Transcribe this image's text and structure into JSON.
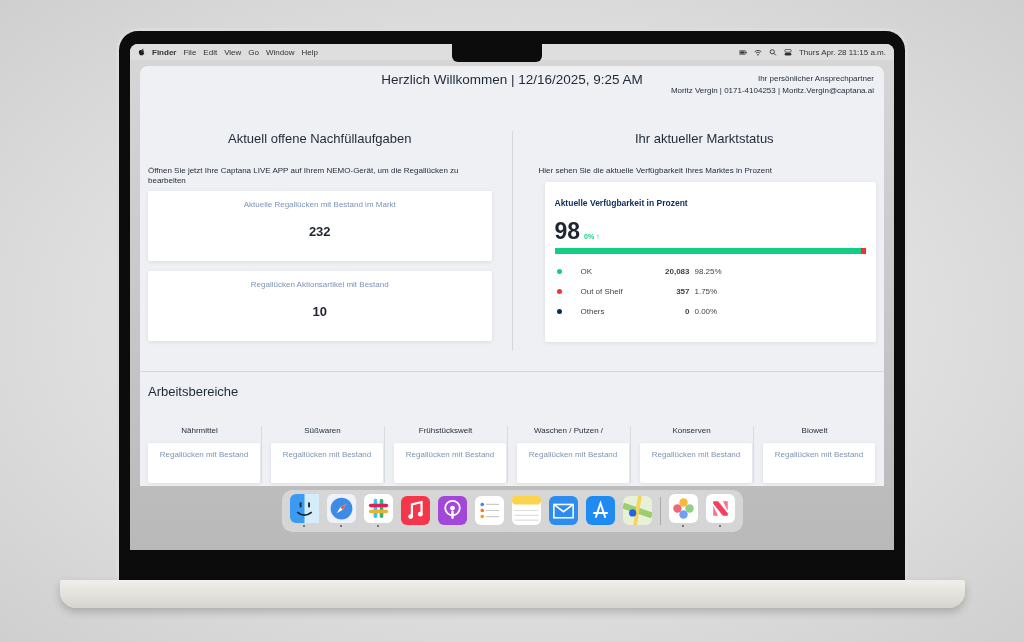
{
  "menubar": {
    "app": "Finder",
    "menus": [
      "File",
      "Edit",
      "View",
      "Go",
      "Window",
      "Help"
    ],
    "clock": "Thurs Apr. 28 11:15 a.m."
  },
  "app": {
    "title": "Herzlich Willkommen | 12/16/2025, 9:25 AM",
    "contact": {
      "label": "Ihr persönlicher Ansprechpartner",
      "line": "Moritz Vergin | 0171-4104253 | Moritz.Vergin@captana.ai"
    },
    "tasks": {
      "title": "Aktuell offene Nachfüllaufgaben",
      "instruction": "Öffnen Sie jetzt Ihre Captana LIVE APP auf Ihrem NEMO-Gerät, um die Regallücken zu bearbeiten",
      "cards": [
        {
          "label": "Aktuelle Regallücken mit Bestand im Markt",
          "value": "232"
        },
        {
          "label": "Regallücken Aktionsartikel mit Bestand",
          "value": "10"
        }
      ]
    },
    "status": {
      "title": "Ihr aktueller Marktstatus",
      "instruction": "Hier sehen Sie die aktuelle Verfügbarkeit Ihres Marktes in Prozent",
      "card": {
        "title": "Aktuelle Verfügbarkeit in Prozent",
        "value": "98",
        "change": "0%",
        "trend": "↑",
        "legend": [
          {
            "label": "OK",
            "count": "20,083",
            "percent": "98.25%",
            "color": "#10cf85",
            "level": 0.9825
          },
          {
            "label": "Out of Shelf",
            "count": "357",
            "percent": "1.75%",
            "color": "#f0352b",
            "level": 0.0175
          },
          {
            "label": "Others",
            "count": "0",
            "percent": "0.00%",
            "color": "#0d2c5c"
          }
        ]
      }
    },
    "areas": {
      "title": "Arbeitsbereiche",
      "columns": [
        {
          "title": "Nährmittel",
          "button": "Regallücken mit Bestand"
        },
        {
          "title": "Süßwaren",
          "button": "Regallücken mit Bestand"
        },
        {
          "title": "Frühstückswelt",
          "button": "Regallücken mit Bestand"
        },
        {
          "title": "Waschen / Putzen /",
          "button": "Regallücken mit Bestand"
        },
        {
          "title": "Konserven",
          "button": "Regallücken mit Bestand"
        },
        {
          "title": "Biowelt",
          "button": "Regallücken mit Bestand"
        }
      ]
    }
  }
}
